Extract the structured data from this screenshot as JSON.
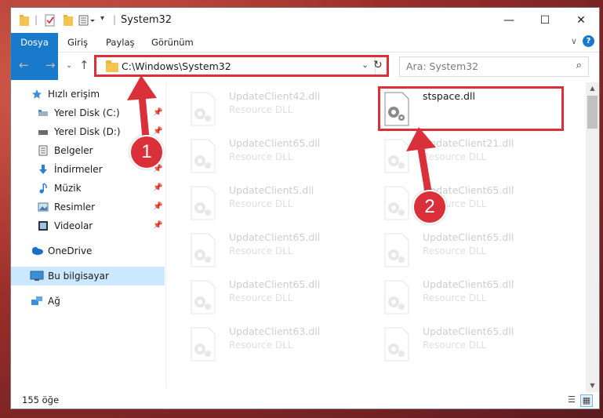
{
  "window": {
    "title": "System32",
    "controls": {
      "minimize": "—",
      "maximize": "☐",
      "close": "✕"
    }
  },
  "ribbon": {
    "tabs": [
      "Dosya",
      "Giriş",
      "Paylaş",
      "Görünüm"
    ]
  },
  "address_bar": {
    "path": "C:\\Windows\\System32",
    "search_placeholder": "Ara: System32"
  },
  "sidebar": {
    "items": [
      {
        "label": "Hızlı erişim",
        "icon": "star-icon",
        "pinned": false
      },
      {
        "label": "Yerel Disk (C:)",
        "icon": "drive-icon",
        "pinned": true
      },
      {
        "label": "Yerel Disk (D:)",
        "icon": "drive-icon",
        "pinned": true
      },
      {
        "label": "Belgeler",
        "icon": "document-icon",
        "pinned": false
      },
      {
        "label": "İndirmeler",
        "icon": "download-icon",
        "pinned": true
      },
      {
        "label": "Müzik",
        "icon": "music-icon",
        "pinned": true
      },
      {
        "label": "Resimler",
        "icon": "pictures-icon",
        "pinned": true
      },
      {
        "label": "Videolar",
        "icon": "video-icon",
        "pinned": true
      },
      {
        "label": "OneDrive",
        "icon": "cloud-icon",
        "pinned": false
      },
      {
        "label": "Bu bilgisayar",
        "icon": "computer-icon",
        "pinned": false,
        "selected": true
      },
      {
        "label": "Ağ",
        "icon": "network-icon",
        "pinned": false
      }
    ]
  },
  "files": {
    "left_column": [
      {
        "name": "UpdateClient42.dll",
        "type": "Resource DLL"
      },
      {
        "name": "UpdateClient65.dll",
        "type": "Resource DLL"
      },
      {
        "name": "UpdateClient5.dll",
        "type": "Resource DLL"
      },
      {
        "name": "UpdateClient65.dll",
        "type": "Resource DLL"
      },
      {
        "name": "UpdateClient65.dll",
        "type": "Resource DLL"
      },
      {
        "name": "UpdateClient63.dll",
        "type": "Resource DLL"
      }
    ],
    "right_column": [
      {
        "name": "stspace.dll",
        "type": "",
        "highlighted": true
      },
      {
        "name": "UpdateClient21.dll",
        "type": "Resource DLL"
      },
      {
        "name": "UpdateClient65.dll",
        "type": "Resource DLL"
      },
      {
        "name": "UpdateClient65.dll",
        "type": "Resource DLL"
      },
      {
        "name": "UpdateClient65.dll",
        "type": "Resource DLL"
      },
      {
        "name": "UpdateClient65.dll",
        "type": "Resource DLL"
      }
    ]
  },
  "status_bar": {
    "item_count": "155 öğe"
  },
  "callouts": [
    "1",
    "2"
  ],
  "colors": {
    "accent": "#1979ca",
    "annotation": "#d9303a",
    "selection": "#cce8ff"
  }
}
